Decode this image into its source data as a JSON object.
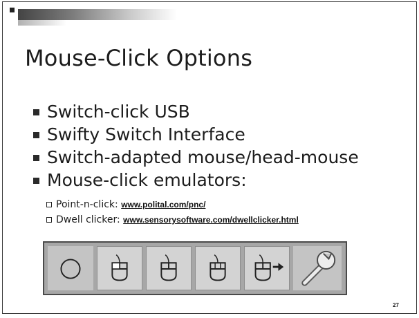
{
  "slide": {
    "title": "Mouse-Click Options",
    "bullets": [
      {
        "label": "Switch-click USB"
      },
      {
        "label": "Swifty Switch Interface"
      },
      {
        "label": "Switch-adapted mouse/head-mouse"
      },
      {
        "label": "Mouse-click emulators:"
      }
    ],
    "sub_bullets": [
      {
        "label": "Point-n-click: ",
        "link": "www.polital.com/pnc/"
      },
      {
        "label": "Dwell clicker: ",
        "link": "www.sensorysoftware.com/dwellclicker.html"
      }
    ],
    "toolbar": {
      "buttons": [
        {
          "icon": "circle-icon"
        },
        {
          "icon": "mouse-left-click-icon"
        },
        {
          "icon": "mouse-left-click-icon"
        },
        {
          "icon": "mouse-middle-click-icon"
        },
        {
          "icon": "mouse-drag-arrow-icon"
        },
        {
          "icon": "wrench-icon"
        }
      ]
    },
    "page_number": "27"
  }
}
